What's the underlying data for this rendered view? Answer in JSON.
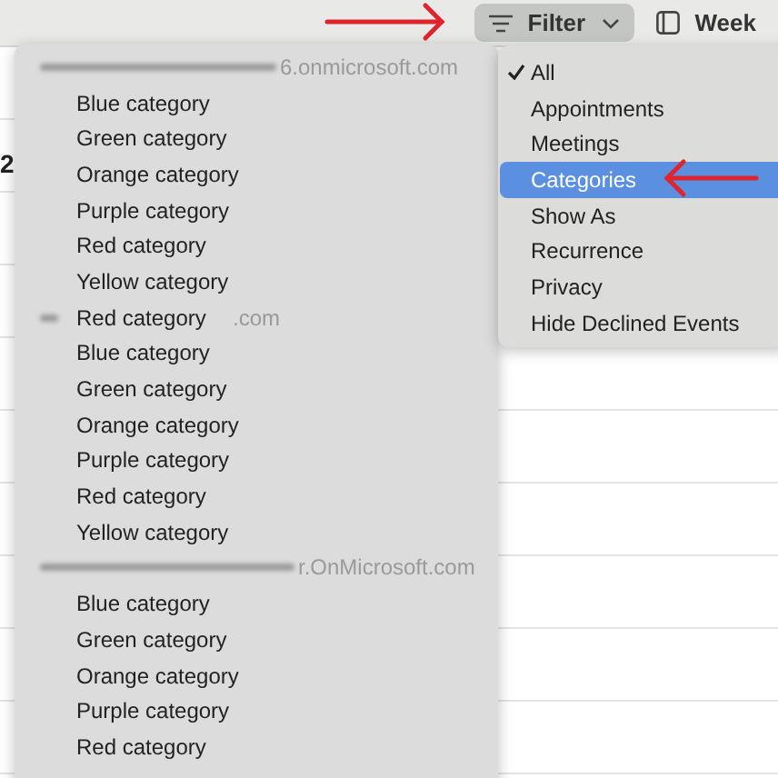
{
  "toolbar": {
    "filter_button": {
      "label": "Filter"
    },
    "view_button": {
      "label": "Week"
    }
  },
  "background": {
    "day_number": "2"
  },
  "category_menu": {
    "groups": [
      {
        "account": "6.onmicrosoft.com",
        "items": [
          "Blue category",
          "Green category",
          "Orange category",
          "Purple category",
          "Red category",
          "Yellow category"
        ]
      },
      {
        "account": ".com",
        "overlay_label": "Red category",
        "items": [
          "Blue category",
          "Green category",
          "Orange category",
          "Purple category",
          "Red category",
          "Yellow category"
        ]
      },
      {
        "account": "r.OnMicrosoft.com",
        "items": [
          "Blue category",
          "Green category",
          "Orange category",
          "Purple category",
          "Red category"
        ]
      }
    ]
  },
  "filter_menu": {
    "items": [
      {
        "label": "All",
        "checked": true,
        "selected": false
      },
      {
        "label": "Appointments",
        "checked": false,
        "selected": false
      },
      {
        "label": "Meetings",
        "checked": false,
        "selected": false
      },
      {
        "label": "Categories",
        "checked": false,
        "selected": true
      },
      {
        "label": "Show As",
        "checked": false,
        "selected": false
      },
      {
        "label": "Recurrence",
        "checked": false,
        "selected": false
      },
      {
        "label": "Privacy",
        "checked": false,
        "selected": false
      },
      {
        "label": "Hide Declined Events",
        "checked": false,
        "selected": false
      }
    ]
  }
}
